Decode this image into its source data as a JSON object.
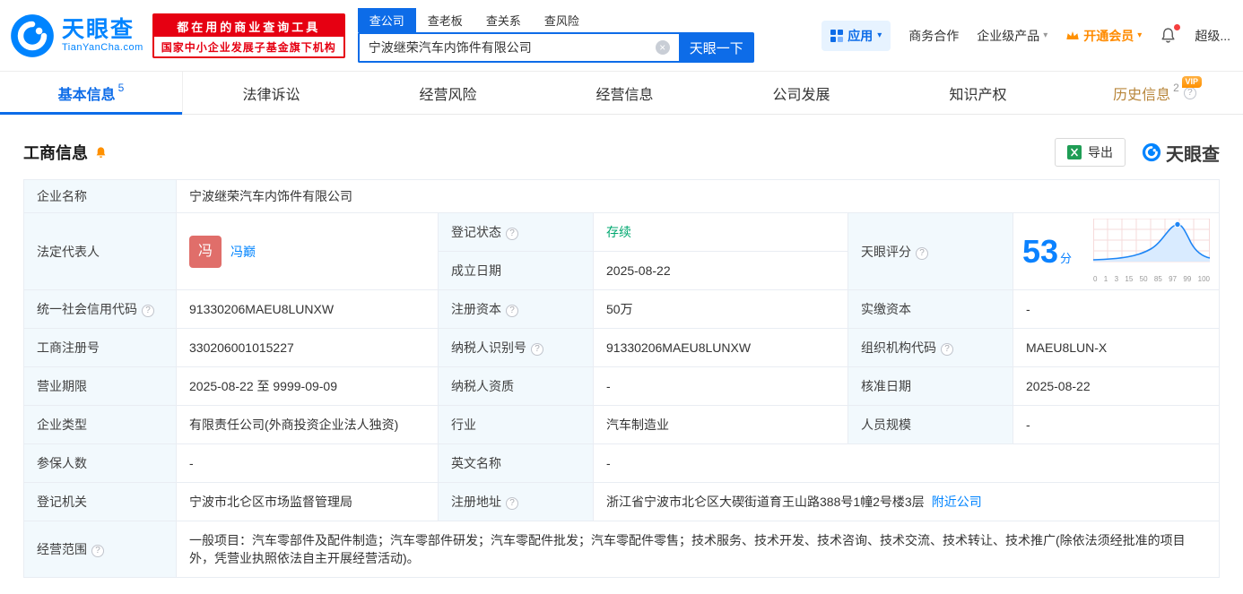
{
  "icons": {
    "clear": "×",
    "caret": "▾",
    "help": "?"
  },
  "header": {
    "logo_title": "天眼查",
    "logo_subtitle": "TianYanCha.com",
    "slogan_line1": "都在用的商业查询工具",
    "slogan_line2": "国家中小企业发展子基金旗下机构",
    "search_tabs": [
      {
        "label": "查公司"
      },
      {
        "label": "查老板"
      },
      {
        "label": "查关系"
      },
      {
        "label": "查风险"
      }
    ],
    "search_value": "宁波继荣汽车内饰件有限公司",
    "search_button": "天眼一下",
    "app_label": "应用",
    "nav_cooperation": "商务合作",
    "nav_enterprise": "企业级产品",
    "nav_member": "开通会员",
    "nav_super": "超级..."
  },
  "tabs": [
    {
      "label": "基本信息",
      "count": "5"
    },
    {
      "label": "法律诉讼"
    },
    {
      "label": "经营风险"
    },
    {
      "label": "经营信息"
    },
    {
      "label": "公司发展"
    },
    {
      "label": "知识产权"
    },
    {
      "label": "历史信息",
      "count": "2",
      "vip": "VIP"
    }
  ],
  "section": {
    "title": "工商信息",
    "export_label": "导出",
    "brand": "天眼查"
  },
  "table": {
    "company_name": {
      "label": "企业名称",
      "value": "宁波继荣汽车内饰件有限公司"
    },
    "legal_rep": {
      "label": "法定代表人",
      "avatar": "冯",
      "value": "冯巅"
    },
    "reg_status": {
      "label": "登记状态",
      "value": "存续"
    },
    "establish_date": {
      "label": "成立日期",
      "value": "2025-08-22"
    },
    "score": {
      "label": "天眼评分",
      "value": "53",
      "unit": "分",
      "axis": [
        "0",
        "1",
        "3",
        "15",
        "50",
        "85",
        "97",
        "99",
        "100"
      ]
    },
    "credit_code": {
      "label": "统一社会信用代码",
      "value": "91330206MAEU8LUNXW"
    },
    "reg_capital": {
      "label": "注册资本",
      "value": "50万"
    },
    "paid_capital": {
      "label": "实缴资本",
      "value": "-"
    },
    "reg_number": {
      "label": "工商注册号",
      "value": "330206001015227"
    },
    "taxpayer_id": {
      "label": "纳税人识别号",
      "value": "91330206MAEU8LUNXW"
    },
    "org_code": {
      "label": "组织机构代码",
      "value": "MAEU8LUN-X"
    },
    "business_term": {
      "label": "营业期限",
      "value": "2025-08-22 至 9999-09-09"
    },
    "taxpayer_quality": {
      "label": "纳税人资质",
      "value": "-"
    },
    "approval_date": {
      "label": "核准日期",
      "value": "2025-08-22"
    },
    "company_type": {
      "label": "企业类型",
      "value": "有限责任公司(外商投资企业法人独资)"
    },
    "industry": {
      "label": "行业",
      "value": "汽车制造业"
    },
    "staff_size": {
      "label": "人员规模",
      "value": "-"
    },
    "insured_count": {
      "label": "参保人数",
      "value": "-"
    },
    "english_name": {
      "label": "英文名称",
      "value": "-"
    },
    "reg_authority": {
      "label": "登记机关",
      "value": "宁波市北仑区市场监督管理局"
    },
    "reg_address": {
      "label": "注册地址",
      "value": "浙江省宁波市北仑区大碶街道育王山路388号1幢2号楼3层",
      "nearby_link": "附近公司"
    },
    "business_scope": {
      "label": "经营范围",
      "value": "一般项目：汽车零部件及配件制造；汽车零部件研发；汽车零配件批发；汽车零配件零售；技术服务、技术开发、技术咨询、技术交流、技术转让、技术推广(除依法须经批准的项目外，凭营业执照依法自主开展经营活动)。"
    }
  }
}
